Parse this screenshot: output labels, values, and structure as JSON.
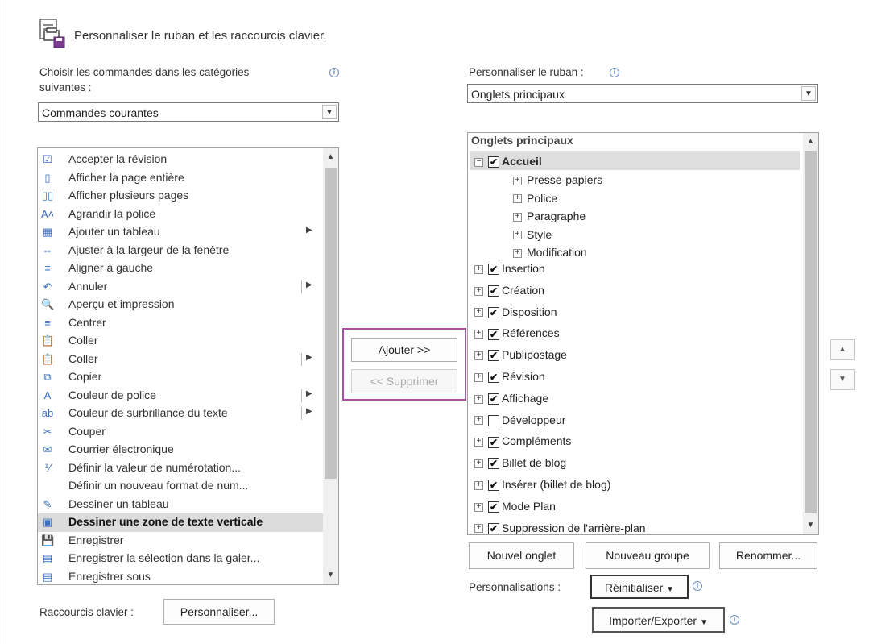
{
  "title": "Personnaliser le ruban et les raccourcis clavier.",
  "left": {
    "choose_label_line1": "Choisir les commandes dans les catégories",
    "choose_label_line2": "suivantes :",
    "combo_value": "Commandes courantes",
    "commands": [
      {
        "label": "Accepter la révision",
        "icon": "check-doc-icon",
        "glyph": "☑",
        "submenu": false
      },
      {
        "label": "Afficher la page entière",
        "icon": "page-icon",
        "glyph": "▯",
        "submenu": false
      },
      {
        "label": "Afficher plusieurs pages",
        "icon": "multi-page-icon",
        "glyph": "▯▯",
        "submenu": false
      },
      {
        "label": "Agrandir la police",
        "icon": "grow-font-icon",
        "glyph": "A˄",
        "submenu": false
      },
      {
        "label": "Ajouter un tableau",
        "icon": "table-icon",
        "glyph": "▦",
        "submenu": true,
        "sep": false
      },
      {
        "label": "Ajuster à la largeur de la fenêtre",
        "icon": "fit-width-icon",
        "glyph": "⇔",
        "submenu": false
      },
      {
        "label": "Aligner à gauche",
        "icon": "align-left-icon",
        "glyph": "≡",
        "submenu": false
      },
      {
        "label": "Annuler",
        "icon": "undo-icon",
        "glyph": "↶",
        "submenu": true,
        "sep": true
      },
      {
        "label": "Aperçu et impression",
        "icon": "print-preview-icon",
        "glyph": "🔍",
        "submenu": false
      },
      {
        "label": "Centrer",
        "icon": "align-center-icon",
        "glyph": "≡",
        "submenu": false
      },
      {
        "label": "Coller",
        "icon": "paste-icon",
        "glyph": "📋",
        "submenu": false
      },
      {
        "label": "Coller",
        "icon": "paste-icon",
        "glyph": "📋",
        "submenu": true,
        "sep": true
      },
      {
        "label": "Copier",
        "icon": "copy-icon",
        "glyph": "⧉",
        "submenu": false
      },
      {
        "label": "Couleur de police",
        "icon": "font-color-icon",
        "glyph": "A",
        "submenu": true,
        "sep": true
      },
      {
        "label": "Couleur de surbrillance du texte",
        "icon": "highlight-icon",
        "glyph": "ab",
        "submenu": true,
        "sep": true
      },
      {
        "label": "Couper",
        "icon": "scissors-icon",
        "glyph": "✂",
        "submenu": false
      },
      {
        "label": "Courrier électronique",
        "icon": "email-icon",
        "glyph": "✉",
        "submenu": false
      },
      {
        "label": "Définir la valeur de numérotation...",
        "icon": "numbering-icon",
        "glyph": "⅟",
        "submenu": false
      },
      {
        "label": "Définir un nouveau format de num...",
        "icon": "",
        "glyph": "",
        "submenu": false
      },
      {
        "label": "Dessiner un tableau",
        "icon": "draw-table-icon",
        "glyph": "✎",
        "submenu": false
      },
      {
        "label": "Dessiner une zone de texte verticale",
        "icon": "vertical-textbox-icon",
        "glyph": "▣",
        "submenu": false,
        "selected": true
      },
      {
        "label": "Enregistrer",
        "icon": "save-icon",
        "glyph": "💾",
        "submenu": false
      },
      {
        "label": "Enregistrer la sélection dans la galer...",
        "icon": "save-selection-icon",
        "glyph": "▤",
        "submenu": false
      },
      {
        "label": "Enregistrer sous",
        "icon": "save-as-icon",
        "glyph": "▤",
        "submenu": false
      }
    ],
    "shortcuts_label": "Raccourcis clavier :",
    "customize_button": "Personnaliser..."
  },
  "middle": {
    "add_button": "Ajouter >>",
    "remove_button": "<< Supprimer"
  },
  "right": {
    "ribbon_label": "Personnaliser le ruban :",
    "combo_value": "Onglets principaux",
    "tree_header": "Onglets principaux",
    "accueil": {
      "label": "Accueil",
      "checked": true
    },
    "accueil_groups": [
      "Presse-papiers",
      "Police",
      "Paragraphe",
      "Style",
      "Modification"
    ],
    "tabs": [
      {
        "label": "Insertion",
        "checked": true
      },
      {
        "label": "Création",
        "checked": true
      },
      {
        "label": "Disposition",
        "checked": true
      },
      {
        "label": "Références",
        "checked": true
      },
      {
        "label": "Publipostage",
        "checked": true
      },
      {
        "label": "Révision",
        "checked": true
      },
      {
        "label": "Affichage",
        "checked": true
      },
      {
        "label": "Développeur",
        "checked": false
      },
      {
        "label": "Compléments",
        "checked": true
      },
      {
        "label": "Billet de blog",
        "checked": true
      },
      {
        "label": "Insérer (billet de blog)",
        "checked": true
      },
      {
        "label": "Mode Plan",
        "checked": true
      },
      {
        "label": "Suppression de l'arrière-plan",
        "checked": true
      }
    ],
    "new_tab_button": "Nouvel onglet",
    "new_group_button": "Nouveau groupe",
    "rename_button": "Renommer...",
    "customizations_label": "Personnalisations :",
    "reset_button": "Réinitialiser",
    "import_export_button": "Importer/Exporter"
  },
  "colors": {
    "highlight_border": "#b04ca8",
    "accent": "#3a6fbf"
  }
}
